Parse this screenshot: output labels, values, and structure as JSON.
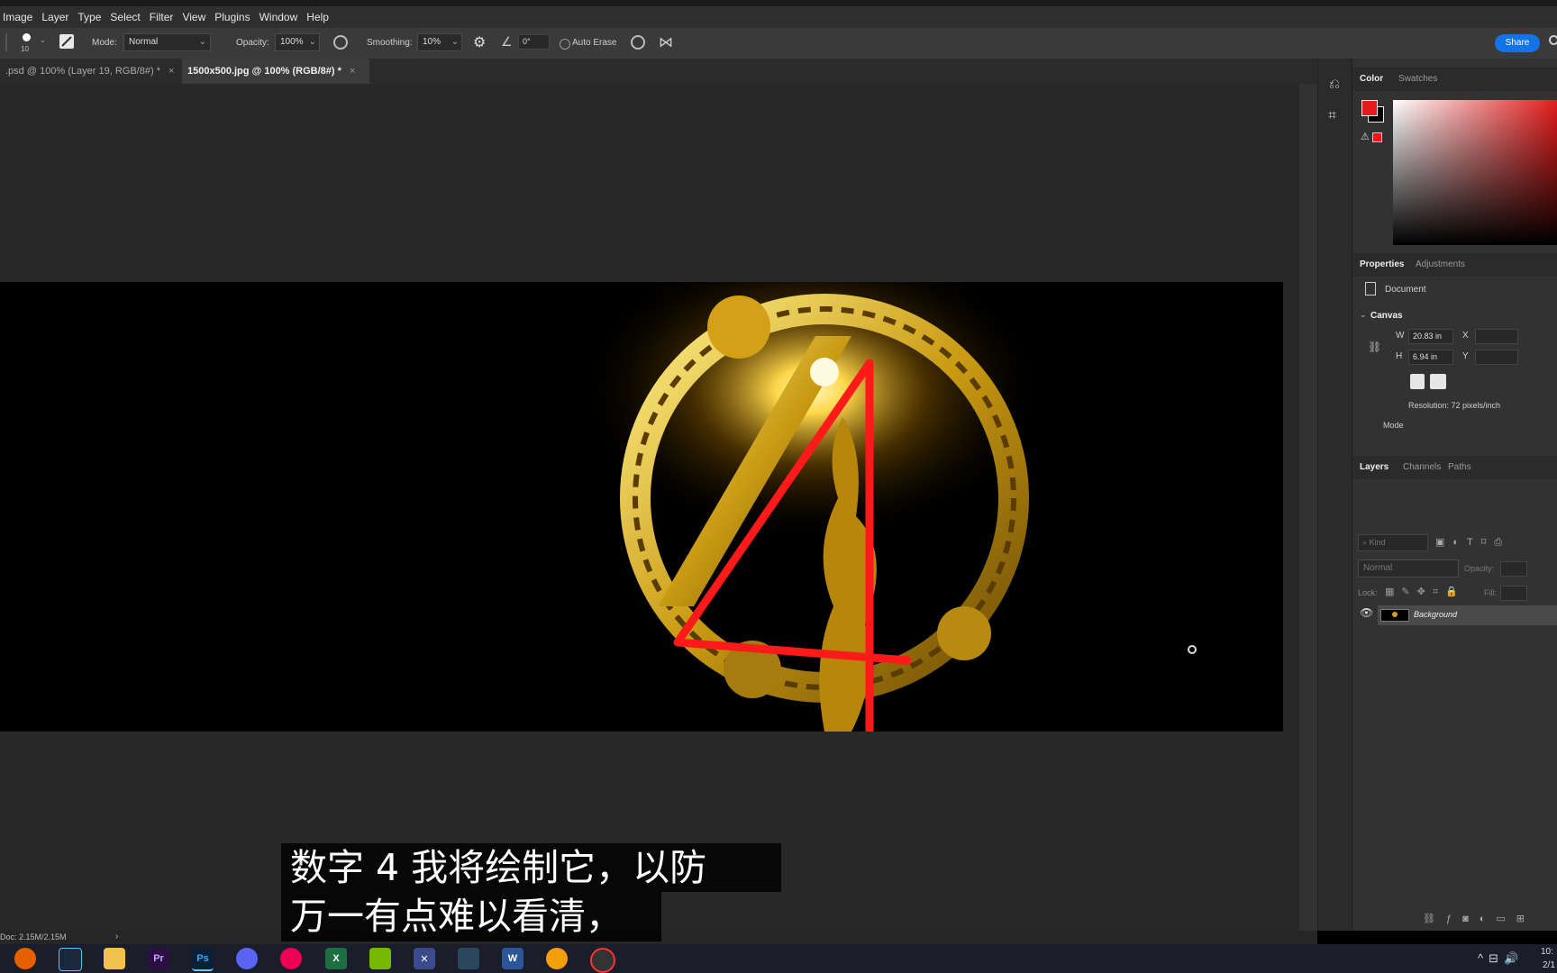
{
  "menu": [
    "Image",
    "Layer",
    "Type",
    "Select",
    "Filter",
    "View",
    "Plugins",
    "Window",
    "Help"
  ],
  "options": {
    "brush_size": "10",
    "mode_label": "Mode:",
    "mode_value": "Normal",
    "opacity_label": "Opacity:",
    "opacity_value": "100%",
    "smoothing_label": "Smoothing:",
    "smoothing_value": "10%",
    "angle_value": "0°",
    "auto_erase_label": "Auto Erase",
    "share_label": "Share"
  },
  "tabs": [
    {
      "label": ".psd @ 100% (Layer 19, RGB/8#) *"
    },
    {
      "label": "1500x500.jpg @ 100% (RGB/8#) *"
    }
  ],
  "tab_close": "×",
  "color_panel": {
    "tabs": [
      "Color",
      "Swatches"
    ],
    "foreground": "#e31b1b",
    "background": "#000000"
  },
  "properties": {
    "tabs": [
      "Properties",
      "Adjustments"
    ],
    "doc_label": "Document",
    "canvas_label": "Canvas",
    "w_label": "W",
    "w_value": "20.83 in",
    "h_label": "H",
    "h_value": "6.94 in",
    "x_label": "X",
    "y_label": "Y",
    "resolution": "Resolution: 72 pixels/inch",
    "mode_label": "Mode"
  },
  "layers": {
    "tabs": [
      "Layers",
      "Channels",
      "Paths"
    ],
    "search_placeholder": "Kind",
    "blend": "Normal",
    "opacity_label": "Opacity:",
    "lock_label": "Lock:",
    "fill_label": "Fill:",
    "items": [
      {
        "name": "Background"
      }
    ]
  },
  "status": {
    "doc": "Doc: 2.15M/2.15M",
    "arrow": "›"
  },
  "subtitle": {
    "line1": "数字 4 我将绘制它，以防",
    "line2": "万一有点难以看清，"
  },
  "taskbar": {
    "time": "10:",
    "date": "2/1"
  }
}
